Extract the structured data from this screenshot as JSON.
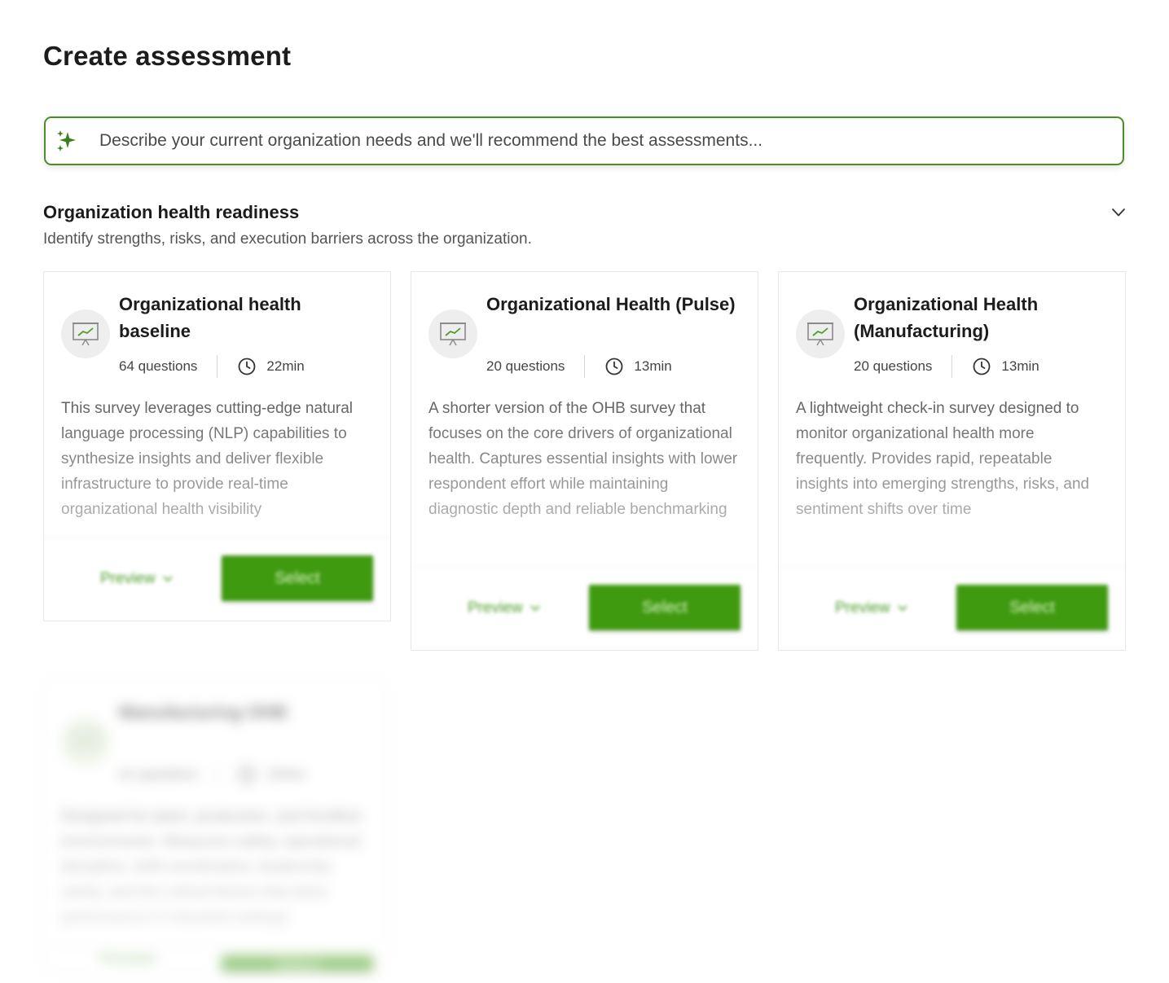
{
  "page": {
    "title": "Create assessment"
  },
  "search": {
    "placeholder": "Describe your current organization needs and we'll recommend the best assessments..."
  },
  "section": {
    "title": "Organization health readiness",
    "subtitle": "Identify strengths, risks, and execution barriers across the organization."
  },
  "cards": [
    {
      "title": "Organizational health baseline",
      "questions": "64 questions",
      "duration": "22min",
      "description": "This survey leverages cutting-edge natural language processing (NLP) capabilities to synthesize insights and deliver flexible infrastructure to provide real-time organizational health visibility",
      "preview_label": "Preview",
      "select_label": "Select"
    },
    {
      "title": "Organizational Health (Pulse)",
      "questions": "20 questions",
      "duration": "13min",
      "description": "A shorter version of the OHB survey that focuses on the core drivers of organizational health. Captures essential insights with lower respondent effort while maintaining diagnostic depth and reliable benchmarking",
      "preview_label": "Preview",
      "select_label": "Select"
    },
    {
      "title": "Organizational Health (Manufacturing)",
      "questions": "20 questions",
      "duration": "13min",
      "description": "A lightweight check-in survey designed to monitor organizational health more frequently. Provides rapid, repeatable insights into emerging strengths, risks, and sentiment shifts over time",
      "preview_label": "Preview",
      "select_label": "Select"
    },
    {
      "title": "Manufacturing OHB",
      "questions": "41 questions",
      "duration": "15min",
      "description": "Designed for plant, production, and frontline environments. Measures safety, operational discipline, shift coordination, leadership clarity, and the critical factors that drive performance in industrial settings",
      "preview_label": "Preview",
      "select_label": "Select"
    }
  ],
  "colors": {
    "accent": "#3f9a0f",
    "search_border": "#4a8f24"
  },
  "icons": [
    "sparkle-icon",
    "chevron-down-icon",
    "presentation-chart-icon",
    "clock-icon"
  ]
}
